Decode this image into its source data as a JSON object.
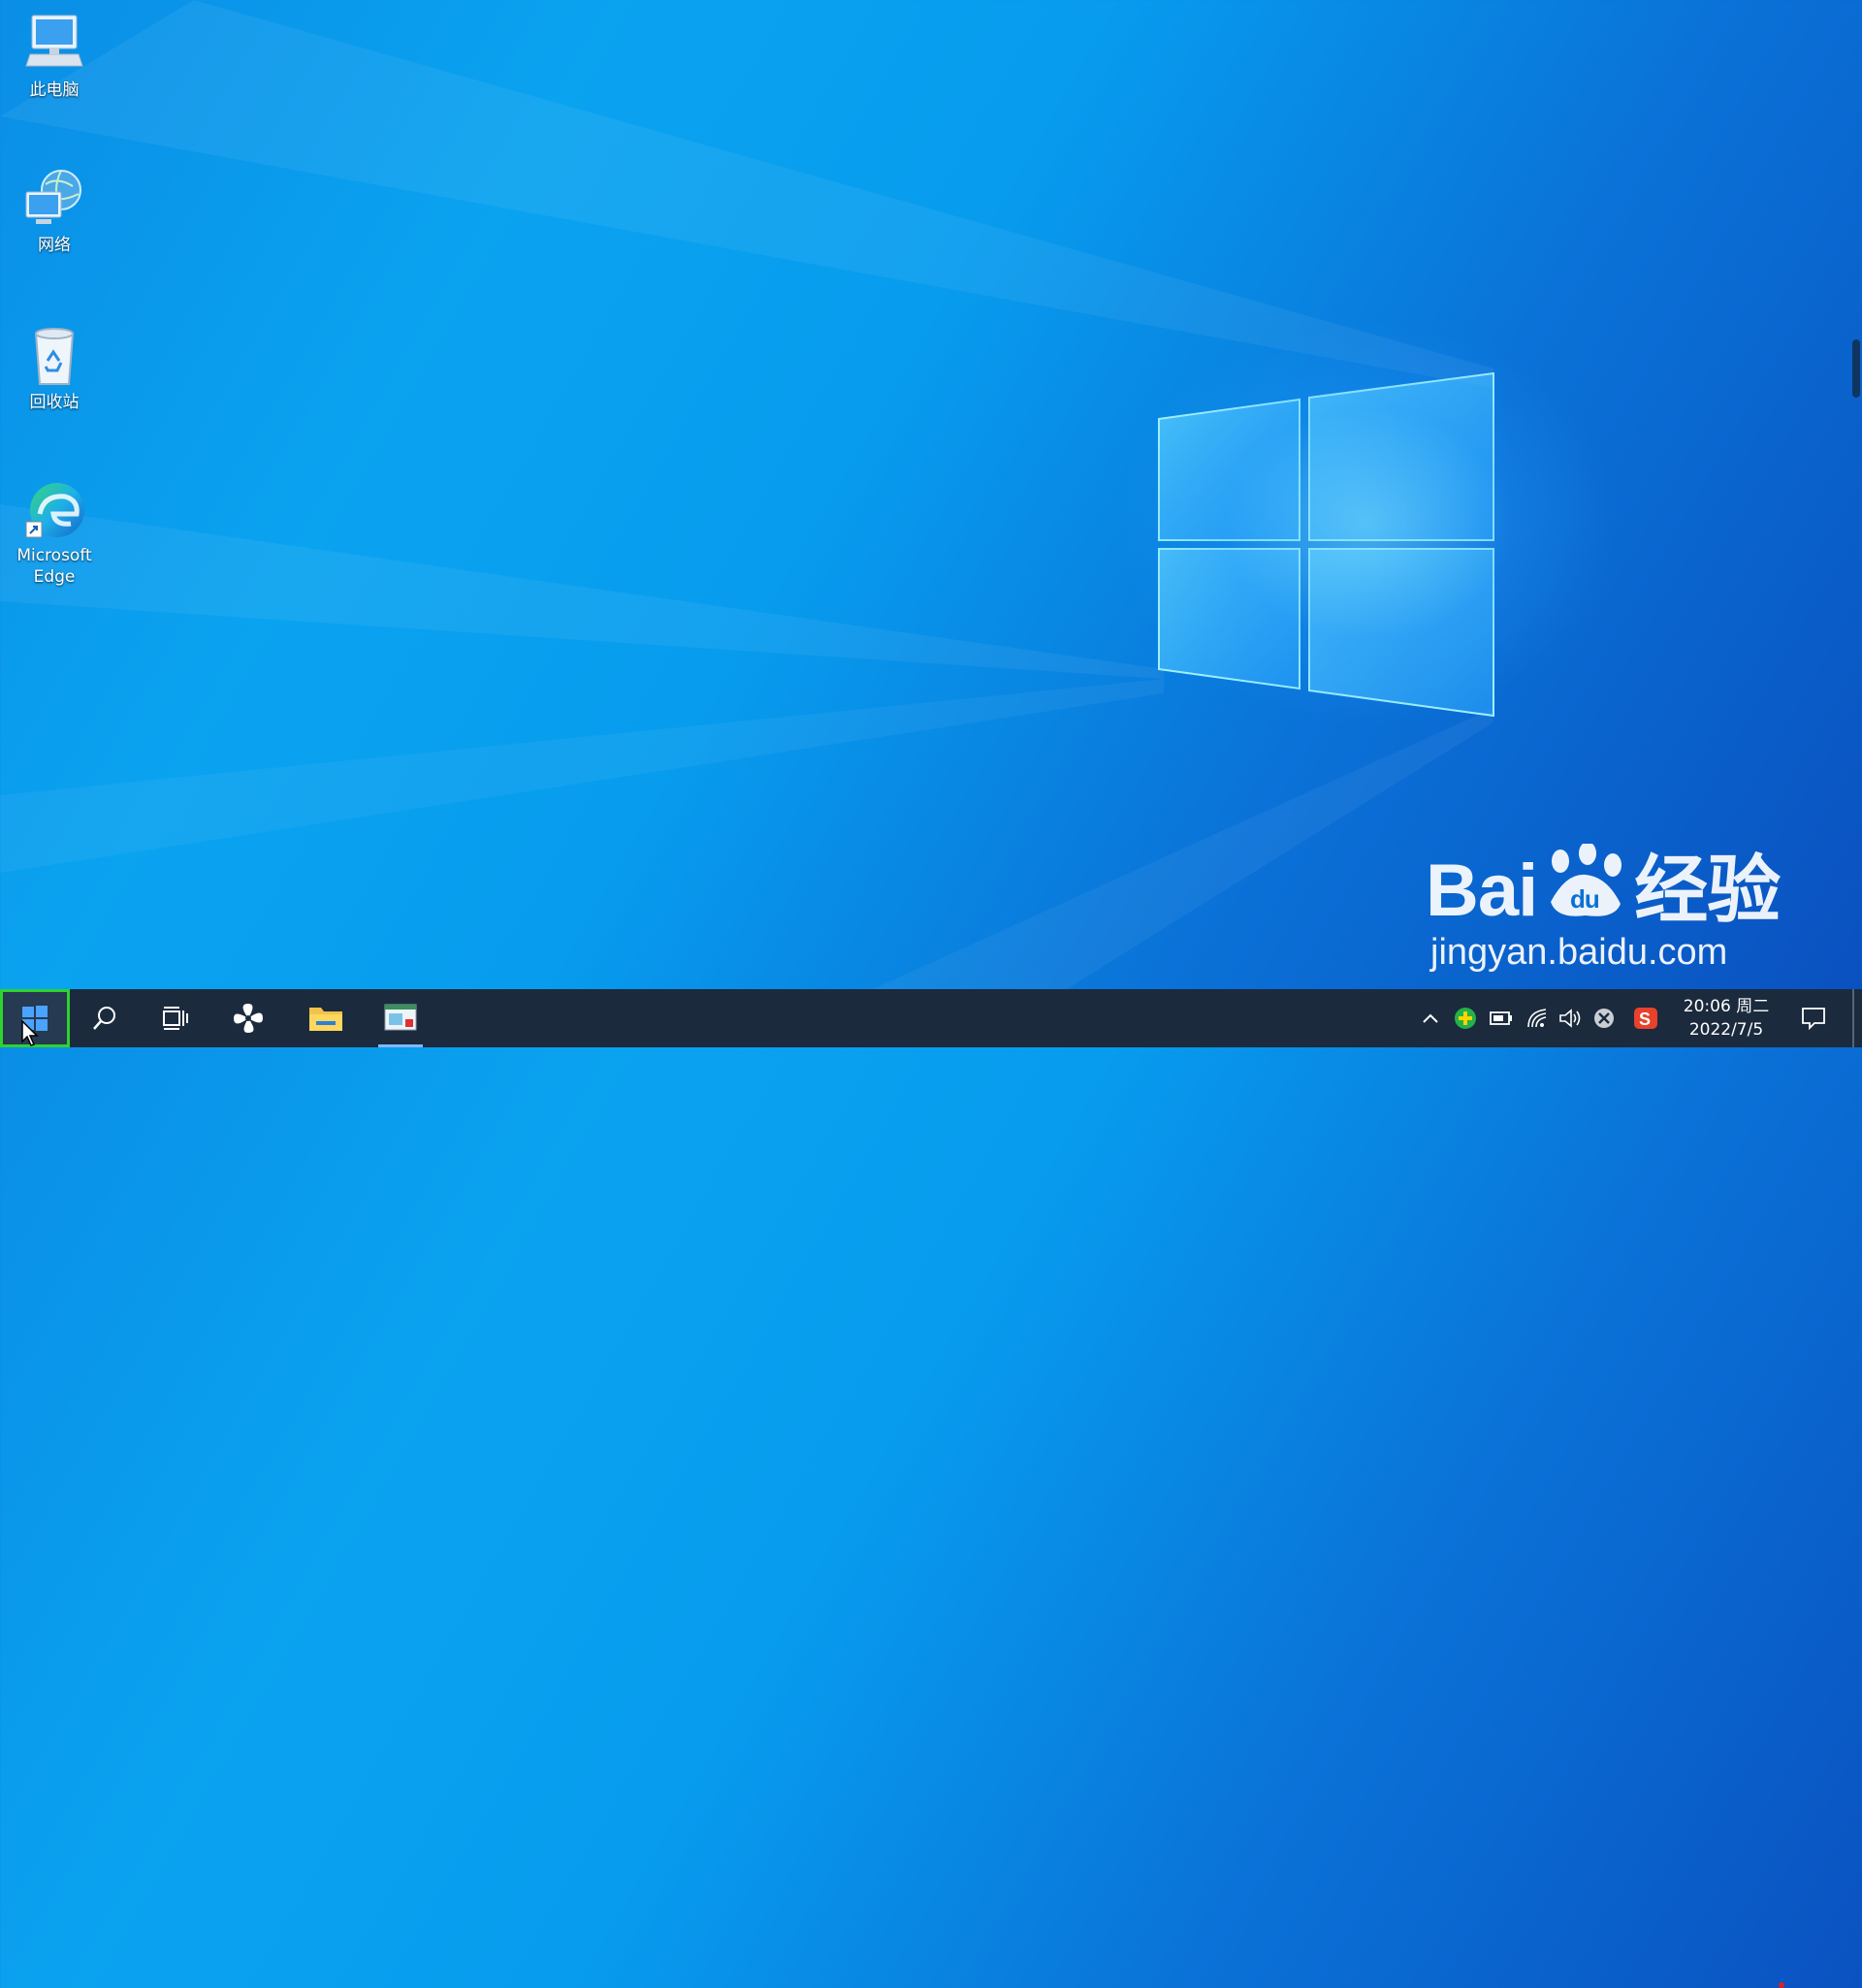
{
  "desktop": {
    "icons": [
      {
        "label": "此电脑"
      },
      {
        "label": "网络"
      },
      {
        "label": "回收站"
      },
      {
        "label": "Microsoft Edge"
      }
    ]
  },
  "taskbar": {
    "clock": {
      "time_day": "20:06 周二",
      "date": "2022/7/5"
    }
  },
  "watermark": {
    "brand": "Bai",
    "brand_cn": "经验",
    "url": "jingyan.baidu.com"
  },
  "colors": {
    "taskbar_bg": "#1b2a3d",
    "start_highlight": "#2fd22f",
    "accent": "#7fb8ff"
  }
}
